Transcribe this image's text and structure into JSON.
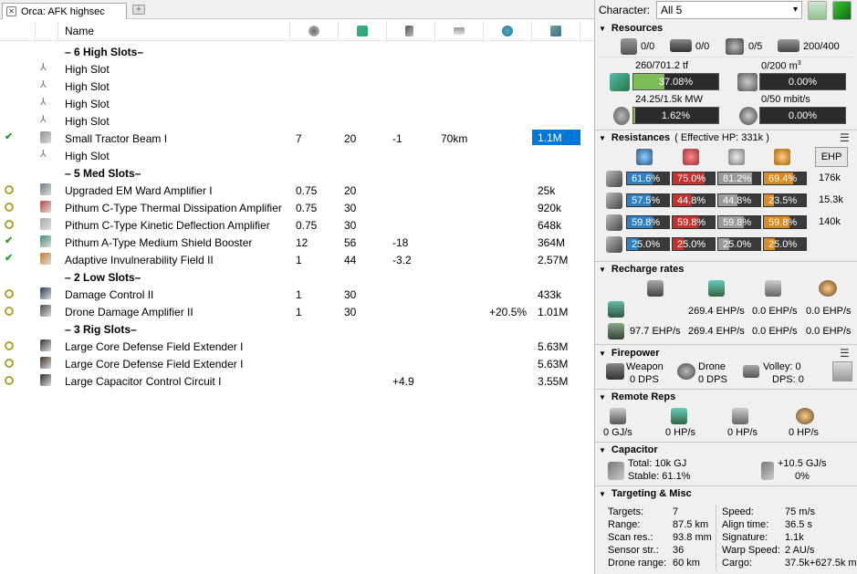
{
  "tab": {
    "title": "Orca: AFK highsec"
  },
  "table": {
    "name_header": "Name",
    "rows": [
      {
        "kind": "section",
        "name": "– 6 High Slots–"
      },
      {
        "kind": "slot",
        "name": "High Slot"
      },
      {
        "kind": "slot",
        "name": "High Slot"
      },
      {
        "kind": "slot",
        "name": "High Slot"
      },
      {
        "kind": "slot",
        "name": "High Slot"
      },
      {
        "kind": "module",
        "state": "check",
        "name": "Small Tractor Beam I",
        "c1": "7",
        "c2": "20",
        "c3": "-1",
        "c4": "70km",
        "c5": "",
        "price": "1.1M",
        "selected": true,
        "icolor": "#8a8f96"
      },
      {
        "kind": "slot",
        "name": "High Slot"
      },
      {
        "kind": "section",
        "name": "– 5 Med Slots–"
      },
      {
        "kind": "module",
        "state": "ring",
        "name": "Upgraded EM Ward Amplifier I",
        "c1": "0.75",
        "c2": "20",
        "c3": "",
        "c4": "",
        "c5": "",
        "price": "25k",
        "icolor": "#6f7a88"
      },
      {
        "kind": "module",
        "state": "ring",
        "name": "Pithum C-Type Thermal Dissipation Amplifier",
        "c1": "0.75",
        "c2": "30",
        "c3": "",
        "c4": "",
        "c5": "",
        "price": "920k",
        "icolor": "#b8453a"
      },
      {
        "kind": "module",
        "state": "ring",
        "name": "Pithum C-Type Kinetic Deflection Amplifier",
        "c1": "0.75",
        "c2": "30",
        "c3": "",
        "c4": "",
        "c5": "",
        "price": "648k",
        "icolor": "#a8a8a8"
      },
      {
        "kind": "module",
        "state": "check",
        "name": "Pithum A-Type Medium Shield Booster",
        "c1": "12",
        "c2": "56",
        "c3": "-18",
        "c4": "",
        "c5": "",
        "price": "364M",
        "icolor": "#3d8e7a"
      },
      {
        "kind": "module",
        "state": "check",
        "name": "Adaptive Invulnerability Field II",
        "c1": "1",
        "c2": "44",
        "c3": "-3.2",
        "c4": "",
        "c5": "",
        "price": "2.57M",
        "icolor": "#c8782a"
      },
      {
        "kind": "section",
        "name": "– 2 Low Slots–"
      },
      {
        "kind": "module",
        "state": "ring",
        "name": "Damage Control II",
        "c1": "1",
        "c2": "30",
        "c3": "",
        "c4": "",
        "c5": "",
        "price": "433k",
        "icolor": "#2a3a55"
      },
      {
        "kind": "module",
        "state": "ring",
        "name": "Drone Damage Amplifier II",
        "c1": "1",
        "c2": "30",
        "c3": "",
        "c4": "",
        "c5": "+20.5%",
        "price": "1.01M",
        "icolor": "#4a4a4a"
      },
      {
        "kind": "section",
        "name": "– 3 Rig Slots–"
      },
      {
        "kind": "module",
        "state": "ring",
        "name": "Large Core Defense Field Extender I",
        "c1": "",
        "c2": "",
        "c3": "",
        "c4": "",
        "c5": "",
        "price": "5.63M",
        "icolor": "#3a3028"
      },
      {
        "kind": "module",
        "state": "ring",
        "name": "Large Core Defense Field Extender I",
        "c1": "",
        "c2": "",
        "c3": "",
        "c4": "",
        "c5": "",
        "price": "5.63M",
        "icolor": "#3a3028"
      },
      {
        "kind": "module",
        "state": "ring",
        "name": "Large Capacitor Control Circuit I",
        "c1": "",
        "c2": "",
        "c3": "+4.9",
        "c4": "",
        "c5": "",
        "price": "3.55M",
        "icolor": "#2d2d2d"
      }
    ]
  },
  "character": {
    "label": "Character:",
    "value": "All 5"
  },
  "resources": {
    "title": "Resources",
    "slots": [
      "0/0",
      "0/0",
      "0/5",
      "200/400"
    ],
    "cpu": {
      "top": "260/701.2 tf",
      "pct": "37.08%",
      "fill": 0.3708
    },
    "drone_bay": {
      "top": "0/200 m",
      "sup": "3",
      "pct": "0.00%",
      "fill": 0
    },
    "pg": {
      "top": "24.25/1.5k MW",
      "pct": "1.62%",
      "fill": 0.0162
    },
    "bandwidth": {
      "top": "0/50 mbit/s",
      "pct": "0.00%",
      "fill": 0
    }
  },
  "resistances": {
    "title": "Resistances",
    "ehp_label": "( Effective HP: 331k )",
    "ehp_button": "EHP",
    "rows": [
      {
        "vals": [
          "61.6%",
          "75.0%",
          "81.2%",
          "69.4%"
        ],
        "fills": [
          0.616,
          0.75,
          0.812,
          0.694
        ],
        "hp": "176k"
      },
      {
        "vals": [
          "57.5%",
          "44.8%",
          "44.8%",
          "23.5%"
        ],
        "fills": [
          0.575,
          0.448,
          0.448,
          0.235
        ],
        "hp": "15.3k"
      },
      {
        "vals": [
          "59.8%",
          "59.8%",
          "59.8%",
          "59.8%"
        ],
        "fills": [
          0.598,
          0.598,
          0.598,
          0.598
        ],
        "hp": "140k"
      },
      {
        "vals": [
          "25.0%",
          "25.0%",
          "25.0%",
          "25.0%"
        ],
        "fills": [
          0.25,
          0.25,
          0.25,
          0.25
        ],
        "hp": ""
      }
    ]
  },
  "recharge": {
    "title": "Recharge rates",
    "row1": [
      "269.4 EHP/s",
      "0.0 EHP/s",
      "0.0 EHP/s"
    ],
    "row2": [
      "97.7 EHP/s",
      "269.4 EHP/s",
      "0.0 EHP/s",
      "0.0 EHP/s"
    ]
  },
  "firepower": {
    "title": "Firepower",
    "weapon": "Weapon",
    "weapon_dps": "0 DPS",
    "drone": "Drone",
    "drone_dps": "0 DPS",
    "volley": "Volley: 0",
    "dps": "DPS: 0"
  },
  "remote": {
    "title": "Remote Reps",
    "vals": [
      "0 GJ/s",
      "0 HP/s",
      "0 HP/s",
      "0 HP/s"
    ]
  },
  "capacitor": {
    "title": "Capacitor",
    "total": "Total:  10k GJ",
    "stable": "Stable: 61.1%",
    "rate": "+10.5 GJ/s",
    "pct": "0%"
  },
  "targeting": {
    "title": "Targeting & Misc",
    "left": [
      [
        "Targets:",
        "7"
      ],
      [
        "Range:",
        "87.5 km"
      ],
      [
        "Scan res.:",
        "93.8 mm"
      ],
      [
        "Sensor str.:",
        "36"
      ],
      [
        "Drone range:",
        "60 km"
      ]
    ],
    "right": [
      [
        "Speed:",
        "75 m/s"
      ],
      [
        "Align time:",
        "36.5 s"
      ],
      [
        "Signature:",
        "1.1k"
      ],
      [
        "Warp Speed:",
        "2 AU/s"
      ],
      [
        "Cargo:",
        "37.5k+627.5k m"
      ]
    ]
  },
  "colors": {
    "em": "#2f7fc4",
    "thermal": "#c8302b",
    "kinetic": "#9a9a9a",
    "explosive": "#d88a20",
    "cpu": "#7dbd58",
    "selected": "#0078d7"
  }
}
